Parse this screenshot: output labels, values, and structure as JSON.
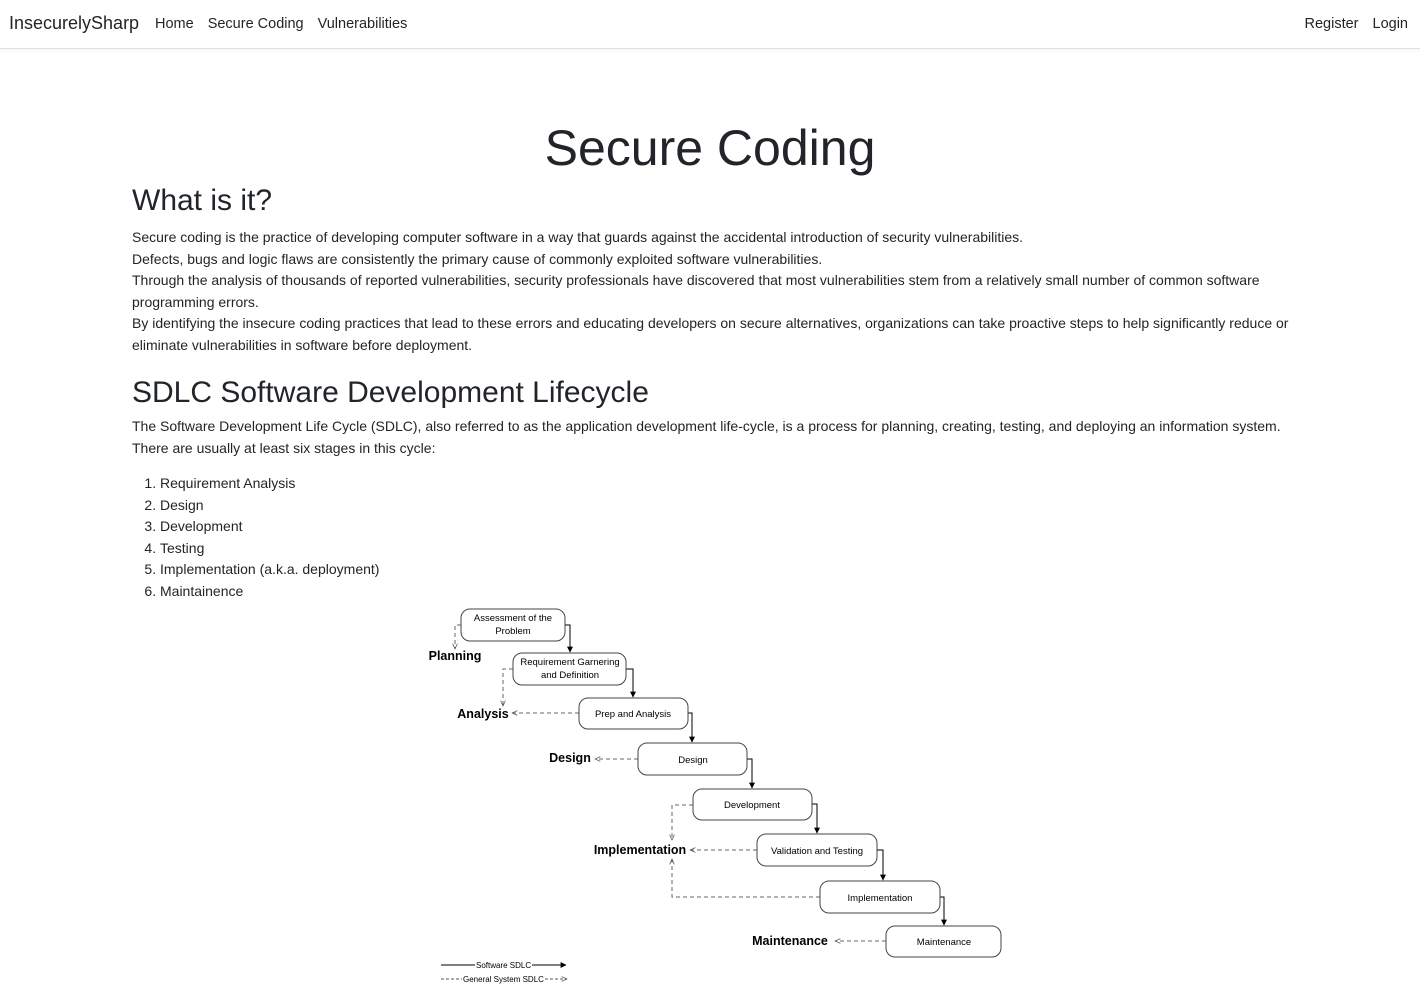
{
  "nav": {
    "brand": "InsecurelySharp",
    "links": [
      "Home",
      "Secure Coding",
      "Vulnerabilities"
    ],
    "right": [
      "Register",
      "Login"
    ]
  },
  "page": {
    "title": "Secure Coding",
    "what_heading": "What is it?",
    "what_lines": [
      "Secure coding is the practice of developing computer software in a way that guards against the accidental introduction of security vulnerabilities.",
      "Defects, bugs and logic flaws are consistently the primary cause of commonly exploited software vulnerabilities.",
      "Through the analysis of thousands of reported vulnerabilities, security professionals have discovered that most vulnerabilities stem from a relatively small number of common software programming errors.",
      "By identifying the insecure coding practices that lead to these errors and educating developers on secure alternatives, organizations can take proactive steps to help significantly reduce or eliminate vulnerabilities in software before deployment."
    ],
    "sdlc_heading": "SDLC Software Development Lifecycle",
    "sdlc_intro": "The Software Development Life Cycle (SDLC), also referred to as the application development life-cycle, is a process for planning, creating, testing, and deploying an information system. There are usually at least six stages in this cycle:",
    "stages": [
      "Requirement Analysis",
      "Design",
      "Development",
      "Testing",
      "Implementation (a.k.a. deployment)",
      "Maintainence"
    ]
  },
  "diagram": {
    "boxes": [
      {
        "name": "box-assessment",
        "lines": [
          "Assessment of the",
          "Problem"
        ]
      },
      {
        "name": "box-requirement",
        "lines": [
          "Requirement Garnering",
          "and Definition"
        ]
      },
      {
        "name": "box-prep-analysis",
        "lines": [
          "Prep and Analysis"
        ]
      },
      {
        "name": "box-design",
        "lines": [
          "Design"
        ]
      },
      {
        "name": "box-development",
        "lines": [
          "Development"
        ]
      },
      {
        "name": "box-validation",
        "lines": [
          "Validation and Testing"
        ]
      },
      {
        "name": "box-implementation",
        "lines": [
          "Implementation"
        ]
      },
      {
        "name": "box-maintenance",
        "lines": [
          "Maintenance"
        ]
      }
    ],
    "phases": [
      "Planning",
      "Analysis",
      "Design",
      "Implementation",
      "Maintenance"
    ],
    "legend": {
      "software": "Software SDLC",
      "general": "General System SDLC"
    }
  }
}
